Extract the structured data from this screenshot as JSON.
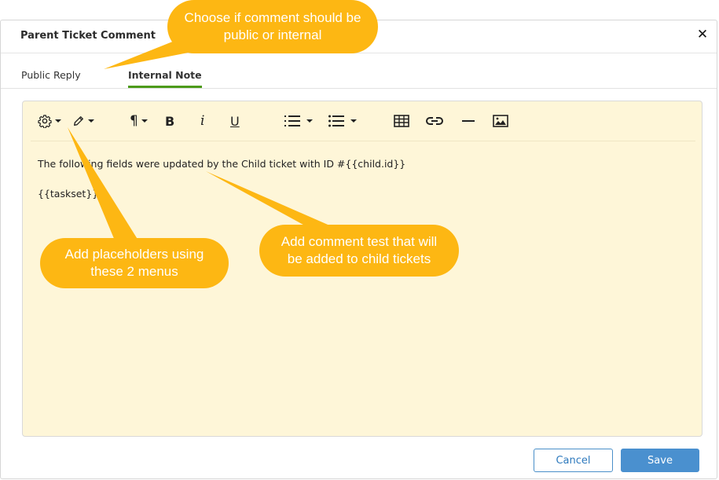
{
  "dialog": {
    "title": "Parent Ticket Comment",
    "close_icon": "close-icon",
    "close_glyph": "✕"
  },
  "tabs": [
    {
      "label": "Public Reply",
      "active": false
    },
    {
      "label": "Internal Note",
      "active": true
    }
  ],
  "toolbar": {
    "paragraph_glyph": "¶",
    "bold_glyph": "B",
    "italic_glyph": "i",
    "underline_glyph": "U",
    "icons": [
      "gear-icon",
      "pencil-icon",
      "paragraph-icon",
      "bold-icon",
      "italic-icon",
      "underline-icon",
      "ordered-list-icon",
      "bulleted-list-icon",
      "table-icon",
      "link-icon",
      "horizontal-rule-icon",
      "image-icon"
    ]
  },
  "editor": {
    "line1": "The following fields were updated by the Child ticket with ID #{{child.id}}",
    "line2": "{{taskset}}"
  },
  "buttons": {
    "cancel": "Cancel",
    "save": "Save"
  },
  "callouts": {
    "tabs_tip": "Choose if comment should be public or internal",
    "menus_tip": "Add placeholders using these 2 menus",
    "comment_tip": "Add comment test that will be added to child tickets"
  },
  "colors": {
    "callout": "#fdb713",
    "active_tab_underline": "#4c9a1a",
    "editor_background": "#fef6d8",
    "primary_button": "#4a90cf"
  }
}
